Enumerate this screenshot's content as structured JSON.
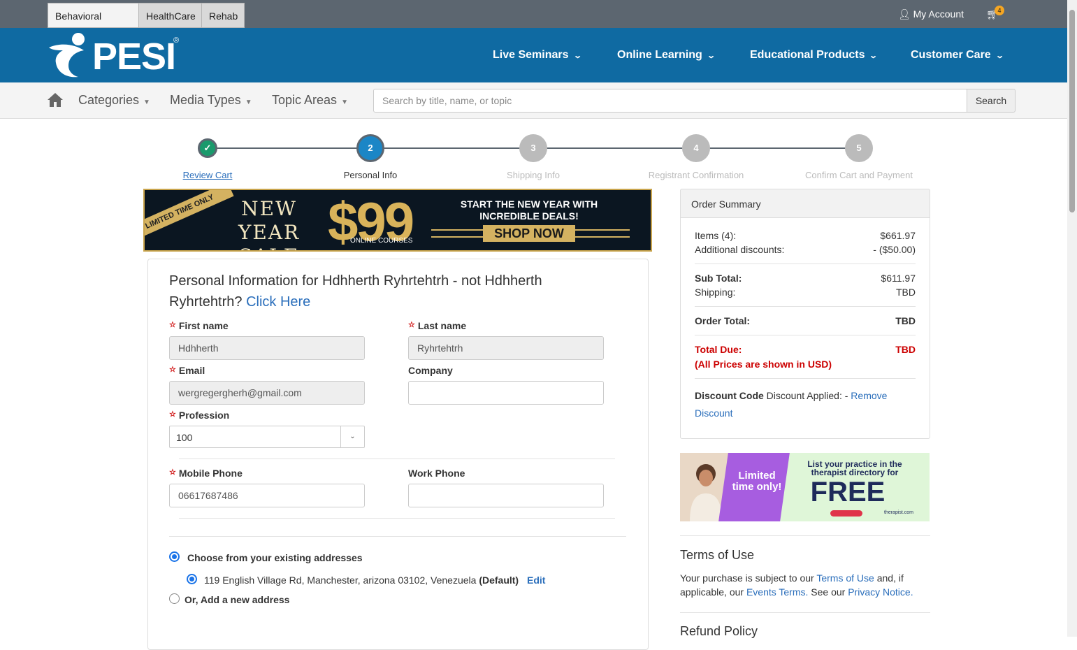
{
  "site_tabs": [
    "Behavioral Health",
    "HealthCare",
    "Rehab"
  ],
  "account": {
    "label": "My Account",
    "cart_count": "4"
  },
  "brand": {
    "logo": "PESI",
    "reg": "®"
  },
  "main_nav": [
    "Live Seminars",
    "Online Learning",
    "Educational Products",
    "Customer Care"
  ],
  "sub_nav": [
    "Categories",
    "Media Types",
    "Topic Areas"
  ],
  "search": {
    "placeholder": "Search by title, name, or topic",
    "button": "Search"
  },
  "steps": [
    {
      "num": "✓",
      "label": "Review Cart",
      "state": "done"
    },
    {
      "num": "2",
      "label": "Personal Info",
      "state": "active"
    },
    {
      "num": "3",
      "label": "Shipping Info",
      "state": "pending"
    },
    {
      "num": "4",
      "label": "Registrant Confirmation",
      "state": "pending"
    },
    {
      "num": "5",
      "label": "Confirm Cart and Payment",
      "state": "pending"
    }
  ],
  "promo": {
    "ribbon": "LIMITED TIME ONLY",
    "title": "NEW YEAR SALE",
    "price": "$99",
    "price_sub": "ONLINE COURSES",
    "tagline": "START THE NEW YEAR WITH INCREDIBLE DEALS!",
    "cta": "SHOP NOW"
  },
  "form": {
    "title_prefix": "Personal Information for Hdhherth Ryhrtehtrh - not Hdhherth Ryhrtehtrh?",
    "title_link": "Click Here",
    "first_name_label": "First name",
    "first_name": "Hdhherth",
    "last_name_label": "Last name",
    "last_name": "Ryhrtehtrh",
    "email_label": "Email",
    "email": "wergregergherh@gmail.com",
    "company_label": "Company",
    "company": "",
    "profession_label": "Profession",
    "profession": "100",
    "mobile_label": "Mobile Phone",
    "mobile": "06617687486",
    "work_label": "Work Phone",
    "work": "",
    "existing_label": "Choose from your existing addresses",
    "address": "119 English Village Rd, Manchester, arizona 03102, Venezuela",
    "address_default": "(Default)",
    "edit": "Edit",
    "new_address_prefix": "Or,",
    "new_address": "Add a new address"
  },
  "summary": {
    "title": "Order Summary",
    "items_label": "Items (4):",
    "items_value": "$661.97",
    "disc_label": "Additional discounts:",
    "disc_value": "- ($50.00)",
    "subtotal_label": "Sub Total:",
    "subtotal_value": "$611.97",
    "shipping_label": "Shipping:",
    "shipping_value": "TBD",
    "order_total_label": "Order Total:",
    "order_total_value": "TBD",
    "due_label": "Total Due:",
    "due_value": "TBD",
    "usd_note": "(All Prices are shown in USD)",
    "discount_code_label": "Discount Code",
    "discount_applied": "Discount Applied: -",
    "remove_discount": "Remove Discount"
  },
  "therapist_ad": {
    "left": "Limited time only!",
    "right": "List your practice in the therapist directory for",
    "free": "FREE",
    "brand": "therapist.com"
  },
  "terms": {
    "title": "Terms of Use",
    "t1": "Your purchase is subject to our",
    "link1": "Terms of Use",
    "t2": "and, if applicable, our",
    "link2": "Events Terms.",
    "t3": "See our",
    "link3": "Privacy Notice."
  },
  "refund": {
    "title": "Refund Policy"
  },
  "colors": {
    "brand_blue": "#0f6aa2",
    "topbar": "#5c6670",
    "done_green": "#1a9a6c",
    "active_blue": "#1b86c6",
    "due_red": "#cc0000"
  }
}
